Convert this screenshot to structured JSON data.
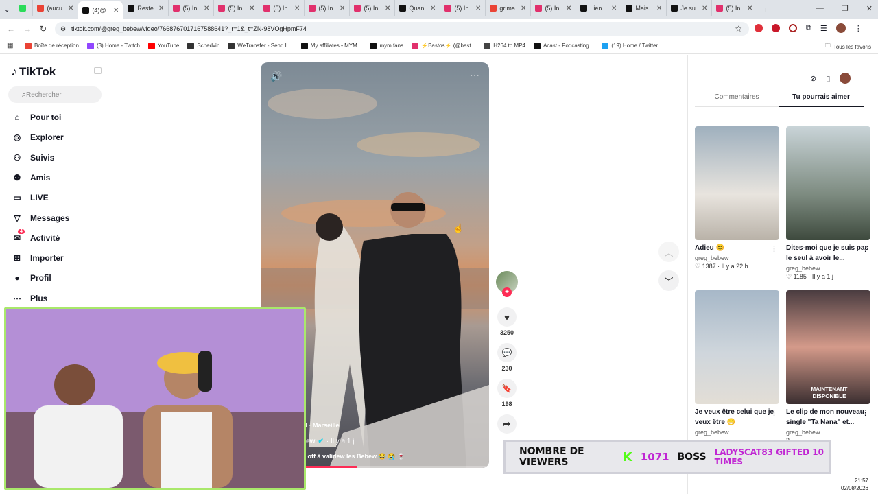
{
  "tabs": [
    {
      "label": "",
      "color": "#2bdc5a",
      "active": false
    },
    {
      "label": "(aucu",
      "color": "#ea4335",
      "active": false
    },
    {
      "label": "(4)@",
      "color": "#111",
      "active": true
    },
    {
      "label": "Reste",
      "color": "#111",
      "active": false
    },
    {
      "label": "(5) In",
      "color": "#e1306c",
      "active": false
    },
    {
      "label": "(5) In",
      "color": "#e1306c",
      "active": false
    },
    {
      "label": "(5) In",
      "color": "#e1306c",
      "active": false
    },
    {
      "label": "(5) In",
      "color": "#e1306c",
      "active": false
    },
    {
      "label": "(5) In",
      "color": "#e1306c",
      "active": false
    },
    {
      "label": "Quan",
      "color": "#111",
      "active": false
    },
    {
      "label": "(5) In",
      "color": "#e1306c",
      "active": false
    },
    {
      "label": "grima",
      "color": "#ea4335",
      "active": false
    },
    {
      "label": "(5) In",
      "color": "#e1306c",
      "active": false
    },
    {
      "label": "Lien",
      "color": "#111",
      "active": false
    },
    {
      "label": "Mais",
      "color": "#111",
      "active": false
    },
    {
      "label": "Je su",
      "color": "#111",
      "active": false
    },
    {
      "label": "(5) In",
      "color": "#e1306c",
      "active": false
    }
  ],
  "url": "tiktok.com/@greg_bebew/video/7668767017167588641?_r=1&_t=ZN-98VOgHpmF74",
  "bookmarks": [
    "Boîte de réception",
    "(3) Home - Twitch",
    "YouTube",
    "Schedvin",
    "WeTransfer - Send L...",
    "My affiliates • MYM...",
    "mym.fans",
    "⚡Bastos⚡ (@bast...",
    "H264 to MP4",
    "Acast - Podcasting...",
    "(19) Home / Twitter"
  ],
  "bookmarks_right": "Tous les favoris",
  "sidebar": {
    "logo": "TikTok",
    "search_placeholder": "Rechercher",
    "items": [
      {
        "label": "Pour toi",
        "icon": "home-icon"
      },
      {
        "label": "Explorer",
        "icon": "compass-icon"
      },
      {
        "label": "Suivis",
        "icon": "following-icon"
      },
      {
        "label": "Amis",
        "icon": "friends-icon"
      },
      {
        "label": "LIVE",
        "icon": "live-icon"
      },
      {
        "label": "Messages",
        "icon": "messages-icon"
      },
      {
        "label": "Activité",
        "icon": "activity-icon"
      },
      {
        "label": "Importer",
        "icon": "upload-icon"
      },
      {
        "label": "Profil",
        "icon": "profile-icon"
      },
      {
        "label": "Plus",
        "icon": "more-icon"
      }
    ],
    "activity_badge": "4"
  },
  "video": {
    "location": "ol · Marseille",
    "author": "bew",
    "time": "· Il y a 1 j",
    "caption": "ir off à validew les Bebew 😂 😭 🍷"
  },
  "actions": {
    "likes": "3250",
    "comments": "230",
    "saves": "198"
  },
  "right": {
    "tab_comments": "Commentaires",
    "tab_suggest": "Tu pourrais aimer",
    "cards": [
      {
        "title": "Adieu 😊",
        "author": "greg_bebew",
        "meta": "♡ 1387 · Il y a 22 h"
      },
      {
        "title": "Dites-moi que je suis pas le seul à avoir le...",
        "author": "greg_bebew",
        "meta": "♡ 1185 · Il y a 1 j"
      },
      {
        "title": "Je veux être celui que je veux être 😁",
        "author": "greg_bebew",
        "meta": ""
      },
      {
        "title": "Le clip de mon nouveau single \"Ta Nana\" et...",
        "author": "greg_bebew",
        "meta": "3 j"
      }
    ],
    "card4_overlay": "MAINTENANT DISPONIBLE"
  },
  "overlay": {
    "viewers_label": "NOMBRE DE VIEWERS",
    "viewers_count": "1071",
    "boss": "BOSS",
    "gift": "LADYSCAT83 GIFTED 10 TIMES"
  },
  "clock": {
    "time": "21:57",
    "date": "02/08/2026"
  }
}
